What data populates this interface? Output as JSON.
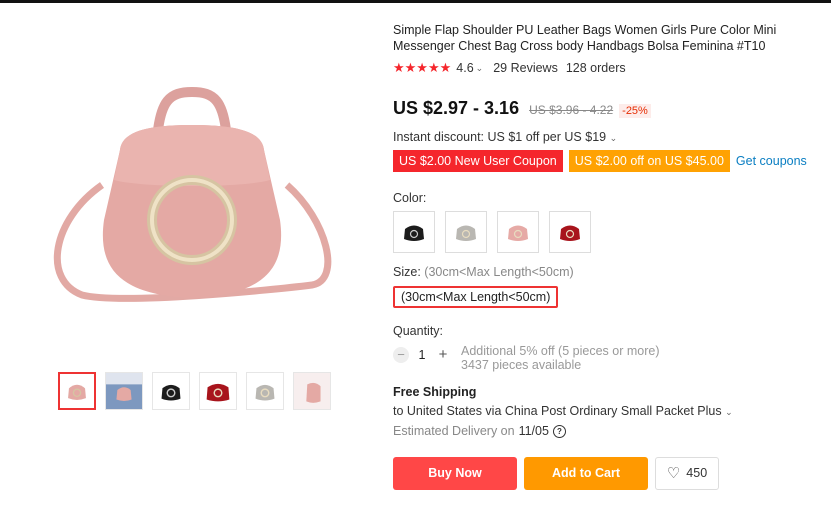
{
  "product": {
    "title": "Simple Flap Shoulder PU Leather Bags Women Girls Pure Color Mini Messenger Chest Bag Cross body Handbags Bolsa Feminina #T10",
    "rating": "4.6",
    "rating_value": 4.6,
    "reviews": "29 Reviews",
    "orders": "128 orders"
  },
  "pricing": {
    "price": "US $2.97 - 3.16",
    "old_price": "US $3.96 - 4.22",
    "discount": "-25%",
    "instant_discount": "Instant discount: US $1 off per US $19",
    "coupon_new_user": "US $2.00 New User Coupon",
    "coupon_off": "US $2.00 off on US $45.00",
    "get_coupons": "Get coupons"
  },
  "color": {
    "label": "Color:",
    "options": [
      "black",
      "silver",
      "pink",
      "red"
    ],
    "colors": [
      "#1c1c1c",
      "#b9b7b2",
      "#e6aaa6",
      "#a8141c"
    ]
  },
  "size": {
    "label": "Size:",
    "selected_hint": "(30cm<Max Length<50cm)",
    "option": "(30cm<Max Length<50cm)"
  },
  "quantity": {
    "label": "Quantity:",
    "minus": "−",
    "plus": "+",
    "value": "1",
    "bulk": "Additional 5% off (5 pieces or more)",
    "available": "3437 pieces available"
  },
  "shipping": {
    "title": "Free Shipping",
    "to": "to United States via China Post Ordinary Small Packet Plus",
    "delivery_label": "Estimated Delivery on",
    "delivery_date": "11/05",
    "help": "?"
  },
  "actions": {
    "buy": "Buy Now",
    "cart": "Add to Cart",
    "wishlist_count": "450"
  },
  "thumbnails": [
    "pink-bag",
    "denim-model",
    "black-bag",
    "red-bag",
    "silver-bag",
    "pink-bag-side"
  ],
  "accent": "#ff4747"
}
